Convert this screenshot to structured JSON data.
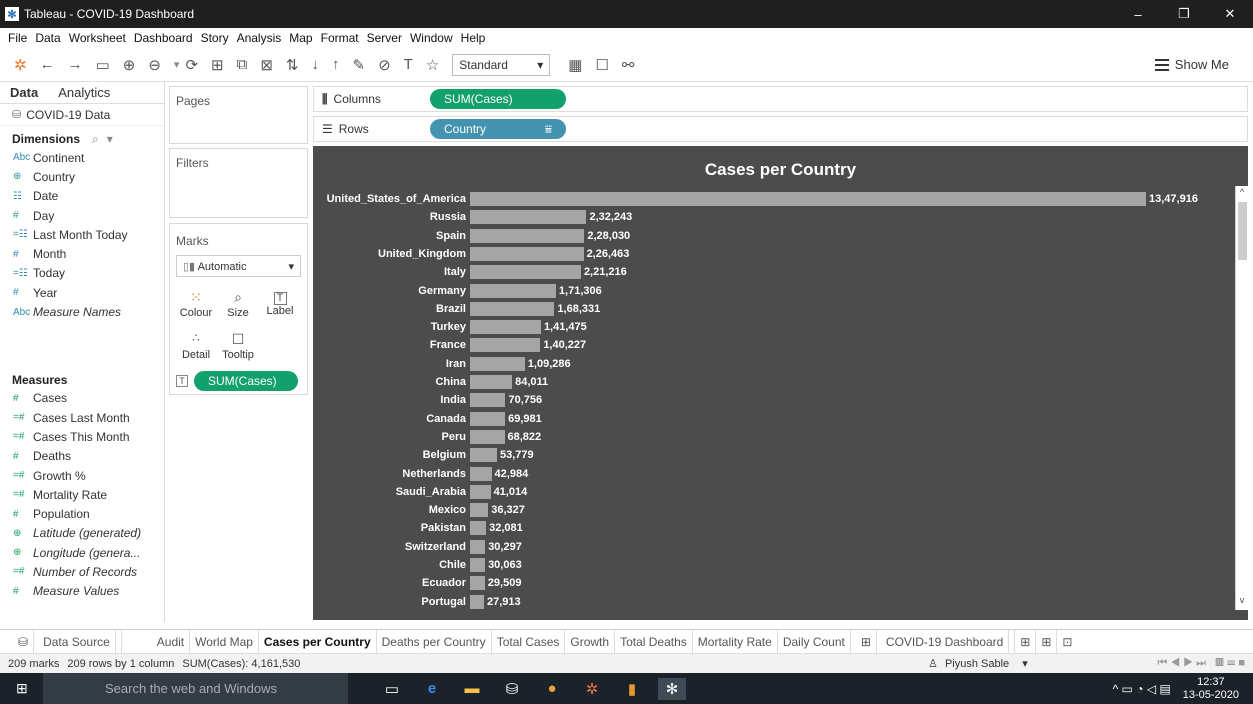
{
  "window": {
    "title": "Tableau - COVID-19 Dashboard",
    "minimize": "–",
    "maximize": "❐",
    "close": "✕"
  },
  "menu": [
    "File",
    "Data",
    "Worksheet",
    "Dashboard",
    "Story",
    "Analysis",
    "Map",
    "Format",
    "Server",
    "Window",
    "Help"
  ],
  "toolbar": {
    "fit_select": "Standard",
    "show_me": "Show Me"
  },
  "data_pane": {
    "tabs": [
      "Data",
      "Analytics"
    ],
    "datasource": "COVID-19 Data",
    "dimensions_header": "Dimensions",
    "dimensions": [
      {
        "icon": "Abc",
        "name": "Continent",
        "italic": false
      },
      {
        "icon": "⊕",
        "name": "Country",
        "italic": false
      },
      {
        "icon": "☷",
        "name": "Date",
        "italic": false
      },
      {
        "icon": "#",
        "name": "Day",
        "italic": false
      },
      {
        "icon": "=☷",
        "name": "Last Month Today",
        "italic": false
      },
      {
        "icon": "#",
        "name": "Month",
        "italic": false
      },
      {
        "icon": "=☷",
        "name": "Today",
        "italic": false
      },
      {
        "icon": "#",
        "name": "Year",
        "italic": false
      },
      {
        "icon": "Abc",
        "name": "Measure Names",
        "italic": true
      }
    ],
    "measures_header": "Measures",
    "measures": [
      {
        "icon": "#",
        "name": "Cases",
        "italic": false
      },
      {
        "icon": "=#",
        "name": "Cases Last Month",
        "italic": false
      },
      {
        "icon": "=#",
        "name": "Cases This Month",
        "italic": false
      },
      {
        "icon": "#",
        "name": "Deaths",
        "italic": false
      },
      {
        "icon": "=#",
        "name": "Growth %",
        "italic": false
      },
      {
        "icon": "=#",
        "name": "Mortality Rate",
        "italic": false
      },
      {
        "icon": "#",
        "name": "Population",
        "italic": false
      },
      {
        "icon": "⊕",
        "name": "Latitude (generated)",
        "italic": true
      },
      {
        "icon": "⊕",
        "name": "Longitude (genera...",
        "italic": true
      },
      {
        "icon": "=#",
        "name": "Number of Records",
        "italic": true
      },
      {
        "icon": "#",
        "name": "Measure Values",
        "italic": true
      }
    ]
  },
  "cards": {
    "pages": "Pages",
    "filters": "Filters",
    "marks": "Marks",
    "marks_type": "Automatic",
    "mark_buttons": [
      {
        "icon": "⁙",
        "label": "Colour"
      },
      {
        "icon": "⌕",
        "label": "Size"
      },
      {
        "icon": "T",
        "label": "Label"
      },
      {
        "icon": "∴",
        "label": "Detail"
      },
      {
        "icon": "☐",
        "label": "Tooltip"
      }
    ],
    "marks_pill": "SUM(Cases)"
  },
  "shelves": {
    "columns_label": "Columns",
    "columns_pill": "SUM(Cases)",
    "rows_label": "Rows",
    "rows_pill": "Country"
  },
  "chart_data": {
    "type": "bar",
    "orientation": "horizontal",
    "title": "Cases per Country",
    "categories": [
      "United_States_of_America",
      "Russia",
      "Spain",
      "United_Kingdom",
      "Italy",
      "Germany",
      "Brazil",
      "Turkey",
      "France",
      "Iran",
      "China",
      "India",
      "Canada",
      "Peru",
      "Belgium",
      "Netherlands",
      "Saudi_Arabia",
      "Mexico",
      "Pakistan",
      "Switzerland",
      "Chile",
      "Ecuador",
      "Portugal"
    ],
    "values": [
      1347916,
      232243,
      228030,
      226463,
      221216,
      171306,
      168331,
      141475,
      140227,
      109286,
      84011,
      70756,
      69981,
      68822,
      53779,
      42984,
      41014,
      36327,
      32081,
      30297,
      30063,
      29509,
      27913
    ],
    "labels": [
      "13,47,916",
      "2,32,243",
      "2,28,030",
      "2,26,463",
      "2,21,216",
      "1,71,306",
      "1,68,331",
      "1,41,475",
      "1,40,227",
      "1,09,286",
      "84,011",
      "70,756",
      "69,981",
      "68,822",
      "53,779",
      "42,984",
      "41,014",
      "36,327",
      "32,081",
      "30,297",
      "30,063",
      "29,509",
      "27,913"
    ],
    "xlim": [
      0,
      1347916
    ],
    "colors": {
      "background": "#4c4c4c",
      "bar": "#a5a5a5",
      "text": "#ffffff"
    }
  },
  "sheet_tabs": [
    "Data Source",
    "Audit",
    "World Map",
    "Cases per Country",
    "Deaths per Country",
    "Total Cases",
    "Growth",
    "Total Deaths",
    "Mortality Rate",
    "Daily Count",
    "COVID-19 Dashboard"
  ],
  "active_sheet": "Cases per Country",
  "status": {
    "marks": "209 marks",
    "rows": "209 rows by 1 column",
    "sum": "SUM(Cases): 4,161,530",
    "user": "Piyush Sable"
  },
  "taskbar": {
    "search_placeholder": "Search the web and Windows",
    "time": "12:37",
    "date": "13-05-2020"
  }
}
